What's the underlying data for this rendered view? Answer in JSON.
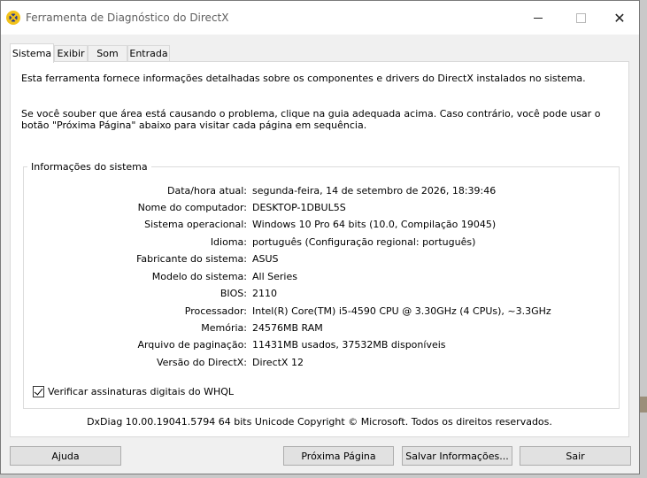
{
  "window": {
    "title": "Ferramenta de Diagnóstico do DirectX",
    "controls": {
      "minimize": "",
      "maximize": "",
      "close": "✕"
    }
  },
  "tabs": [
    {
      "label": "Sistema",
      "active": true
    },
    {
      "label": "Exibir",
      "active": false
    },
    {
      "label": "Som",
      "active": false
    },
    {
      "label": "Entrada",
      "active": false
    }
  ],
  "panel": {
    "intro": "Esta ferramenta fornece informações detalhadas sobre os componentes e drivers do DirectX instalados no sistema.",
    "instructions": "Se você souber que área está causando o problema, clique na guia adequada acima. Caso contrário, você pode usar o botão \"Próxima Página\" abaixo para visitar cada página em sequência.",
    "group_title": "Informações do sistema",
    "system_info": [
      {
        "label": "Data/hora atual:",
        "value": "segunda-feira, 14 de setembro de 2026, 18:39:46"
      },
      {
        "label": "Nome do computador:",
        "value": "DESKTOP-1DBUL5S"
      },
      {
        "label": "Sistema operacional:",
        "value": "Windows 10 Pro 64 bits (10.0, Compilação 19045)"
      },
      {
        "label": "Idioma:",
        "value": "português (Configuração regional: português)"
      },
      {
        "label": "Fabricante do sistema:",
        "value": "ASUS"
      },
      {
        "label": "Modelo do sistema:",
        "value": "All Series"
      },
      {
        "label": "BIOS:",
        "value": "2110"
      },
      {
        "label": "Processador:",
        "value": "Intel(R) Core(TM) i5-4590 CPU @ 3.30GHz (4 CPUs), ~3.3GHz"
      },
      {
        "label": "Memória:",
        "value": "24576MB RAM"
      },
      {
        "label": "Arquivo de paginação:",
        "value": "11431MB usados, 37532MB disponíveis"
      },
      {
        "label": "Versão do DirectX:",
        "value": "DirectX 12"
      }
    ],
    "whql": {
      "label": "Verificar assinaturas digitais do WHQL",
      "checked": true
    },
    "copyright": "DxDiag 10.00.19041.5794 64 bits Unicode  Copyright © Microsoft. Todos os direitos reservados."
  },
  "buttons": {
    "help": "Ajuda",
    "next_page": "Próxima Página",
    "save_info": "Salvar Informações...",
    "exit": "Sair"
  },
  "colors": {
    "window_bg": "#f0f0f0",
    "panel_bg": "#ffffff",
    "button_bg": "#e1e1e1",
    "title_text": "#5f5f5f"
  }
}
